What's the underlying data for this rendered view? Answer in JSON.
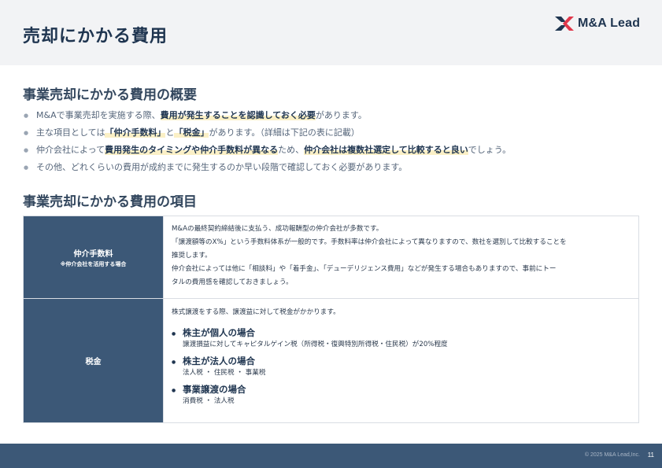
{
  "header": {
    "title": "売却にかかる費用",
    "logo_text": "M&A Lead"
  },
  "overview": {
    "title": "事業売却にかかる費用の概要",
    "bullets": [
      {
        "parts": [
          {
            "text": "M&Aで事業売却を実施する際、",
            "bold": false
          },
          {
            "text": "費用が発生することを認識しておく必要",
            "bold": true
          },
          {
            "text": "があります。",
            "bold": false
          }
        ]
      },
      {
        "parts": [
          {
            "text": "主な項目としては",
            "bold": false
          },
          {
            "text": "「仲介手数料」",
            "bold": true
          },
          {
            "text": "と",
            "bold": false
          },
          {
            "text": "「税金」",
            "bold": true
          },
          {
            "text": "があります。（詳細は下記の表に記載）",
            "bold": false
          }
        ]
      },
      {
        "parts": [
          {
            "text": "仲介会社によって",
            "bold": false
          },
          {
            "text": "費用発生のタイミングや仲介手数料が異なる",
            "bold": true
          },
          {
            "text": "ため、",
            "bold": false
          },
          {
            "text": "仲介会社は複数社選定して比較すると良い",
            "bold": true
          },
          {
            "text": "でしょう。",
            "bold": false
          }
        ]
      },
      {
        "parts": [
          {
            "text": "その他、どれくらいの費用が成約までに発生するのか早い段階で確認しておく必要があります。",
            "bold": false
          }
        ]
      }
    ]
  },
  "items": {
    "title": "事業売却にかかる費用の項目",
    "fee": {
      "label": "仲介手数料",
      "sublabel": "※仲介会社を活用する場合",
      "lines": [
        "M&Aの最終契約締結後に支払う、成功報酬型の仲介会社が多数です。",
        "「譲渡額等のX%」という手数料体系が一般的です。手数料率は仲介会社によって異なりますので、数社を選別して比較することを",
        "推奨します。",
        "仲介会社によっては他に「相談料」や「着手金」、「デューデリジェンス費用」などが発生する場合もありますので、事前にトー",
        "タルの費用感を確認しておきましょう。"
      ]
    },
    "tax": {
      "label": "税金",
      "intro": "株式譲渡をする際、譲渡益に対して税金がかかります。",
      "cases": [
        {
          "head": "株主が個人の場合",
          "detail": "譲渡損益に対してキャピタルゲイン税（所得税・復興特別所得税・住民税）が20%程度"
        },
        {
          "head": "株主が法人の場合",
          "detail": "法人税 ・ 住民税 ・ 事業税"
        },
        {
          "head": "事業譲渡の場合",
          "detail": "消費税 ・ 法人税"
        }
      ]
    }
  },
  "footer": {
    "copyright": "© 2025 M&A Lead,Inc.",
    "page": "11"
  },
  "colors": {
    "navy": "#1f3550",
    "label_bg": "#3c5877",
    "highlight": "#fbf0c6",
    "header_bg": "#f2f3f5"
  }
}
